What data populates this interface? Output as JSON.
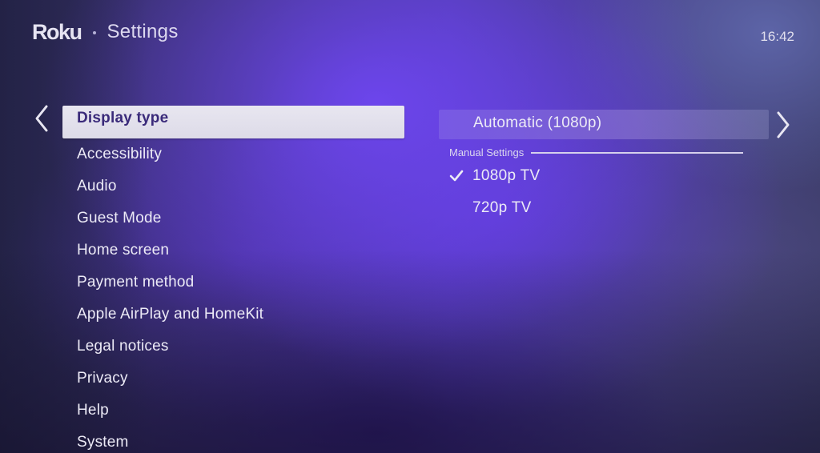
{
  "header": {
    "logo": "Roku",
    "title": "Settings",
    "clock": "16:42"
  },
  "menu": {
    "selected_index": 0,
    "items": [
      {
        "label": "Display type"
      },
      {
        "label": "Accessibility"
      },
      {
        "label": "Audio"
      },
      {
        "label": "Guest Mode"
      },
      {
        "label": "Home screen"
      },
      {
        "label": "Payment method"
      },
      {
        "label": "Apple AirPlay and HomeKit"
      },
      {
        "label": "Legal notices"
      },
      {
        "label": "Privacy"
      },
      {
        "label": "Help"
      },
      {
        "label": "System"
      }
    ]
  },
  "display_type": {
    "automatic_option": "Automatic (1080p)",
    "manual_section_label": "Manual Settings",
    "options": [
      {
        "label": "1080p TV",
        "checked": true
      },
      {
        "label": "720p TV",
        "checked": false
      }
    ]
  },
  "icons": {
    "back": "chevron-left-icon",
    "forward": "chevron-right-icon",
    "check": "checkmark-icon"
  },
  "colors": {
    "selected_bg": "#e4e2ee",
    "selected_text": "#3a2a7a",
    "accent_purple": "#6a46e8",
    "text": "#eceaf6"
  }
}
